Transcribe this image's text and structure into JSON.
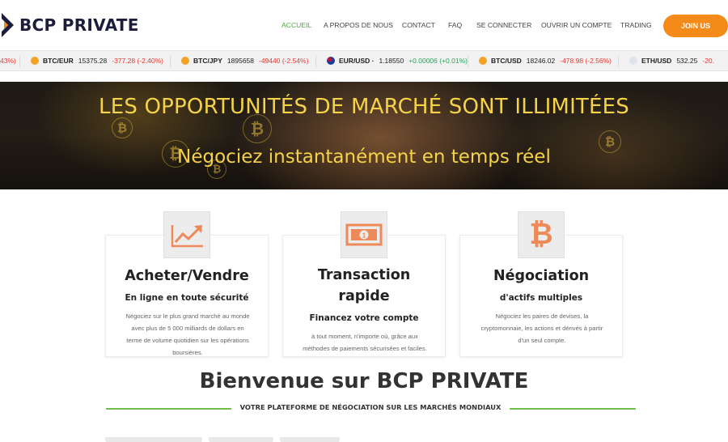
{
  "brand": {
    "name": "BCP PRIVATE"
  },
  "nav": {
    "items": [
      "ACCUEIL",
      "A PROPOS DE NOUS",
      "CONTACT",
      "FAQ",
      "SE CONNECTER",
      "OUVRIR UN COMPTE",
      "TRADING"
    ],
    "active": "ACCUEIL",
    "join_label": "JOIN US"
  },
  "colors": {
    "accent_orange": "#f48a17",
    "active_green": "#4eae3b",
    "hero_text": "#f5d247",
    "rule_green": "#6fbd4a",
    "down_red": "#e53935",
    "up_green": "#27a35a"
  },
  "ticker": [
    {
      "pair": "",
      "price": "",
      "change": "43%)",
      "direction": "down",
      "icon": "none"
    },
    {
      "pair": "BTC/EUR",
      "price": "15375.28",
      "change": "-377.28 (-2.40%)",
      "direction": "down",
      "icon": "bitcoin-icon"
    },
    {
      "pair": "BTC/JPY",
      "price": "1895658",
      "change": "-49440 (-2.54%)",
      "direction": "down",
      "icon": "bitcoin-icon"
    },
    {
      "pair": "EUR/USD ·",
      "price": "1.18550",
      "change": "+0.00006 (+0.01%)",
      "direction": "up",
      "icon": "flag-icon"
    },
    {
      "pair": "BTC/USD",
      "price": "18246.02",
      "change": "-478.98 (-2.56%)",
      "direction": "down",
      "icon": "bitcoin-icon"
    },
    {
      "pair": "ETH/USD",
      "price": "532.25",
      "change": "-20.",
      "direction": "down",
      "icon": "ethereum-icon"
    }
  ],
  "hero": {
    "title": "LES OPPORTUNITÉS DE MARCHÉ SONT ILLIMITÉES",
    "subtitle": "Négociez instantanément en temps réel"
  },
  "features": [
    {
      "icon": "chart-trend-icon",
      "title": "Acheter/Vendre",
      "subtitle": "En ligne en toute sécurité",
      "text": [
        "Négociez sur le plus grand marché au monde",
        "avec plus de 5 000 milliards de dollars en",
        "terme de volume quotidien sur les opérations",
        "boursières."
      ]
    },
    {
      "icon": "banknote-icon",
      "title_lines": [
        "Transaction",
        "rapide"
      ],
      "subtitle": "Financez votre compte",
      "text": [
        "à tout moment, n'importe où, grâce aux",
        "méthodes de paiements sécurisées et faciles."
      ]
    },
    {
      "icon": "bitcoin-icon",
      "title": "Négociation",
      "subtitle": "d'actifs multiples",
      "text": [
        "Négociez les paires de devises, la",
        "cryptomonnaie, les actions et dérivés à partir",
        "d'un seul compte."
      ]
    }
  ],
  "welcome": {
    "title": "Bienvenue sur BCP PRIVATE",
    "tagline": "VOTRE PLATEFORME DE NÉGOCIATION SUR LES MARCHÉS MONDIAUX"
  }
}
